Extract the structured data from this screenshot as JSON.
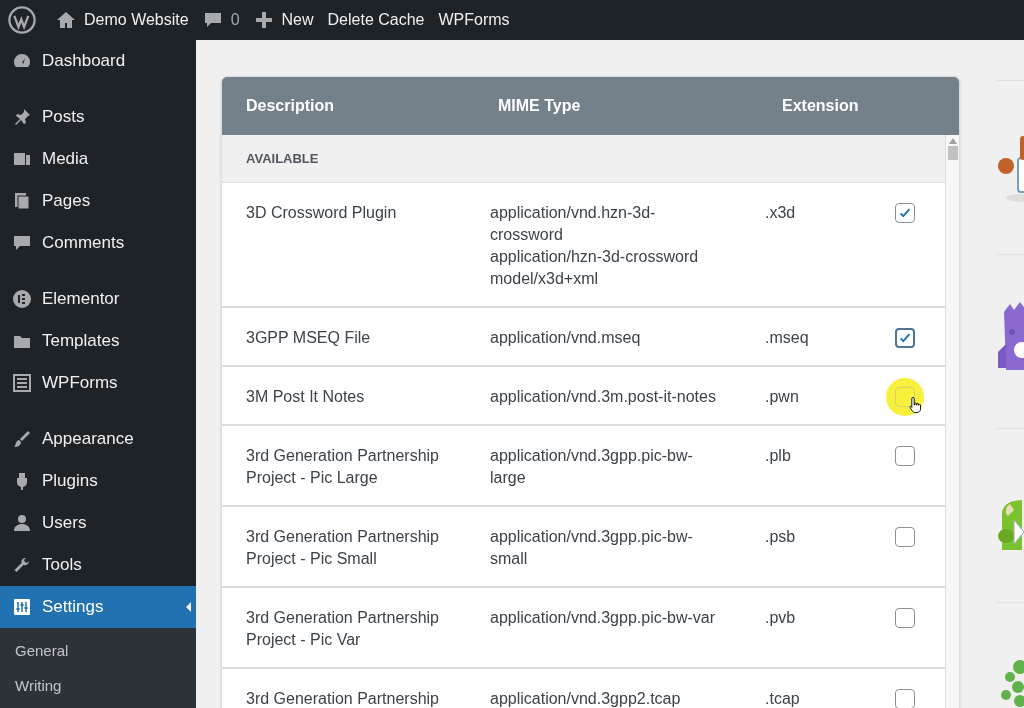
{
  "admin_bar": {
    "items": [
      {
        "kind": "logo"
      },
      {
        "kind": "home",
        "label": "Demo Website"
      },
      {
        "kind": "comments",
        "label": "0"
      },
      {
        "kind": "new",
        "label": "New"
      },
      {
        "kind": "text",
        "label": "Delete Cache"
      },
      {
        "kind": "text",
        "label": "WPForms"
      }
    ]
  },
  "sidebar": {
    "items": [
      {
        "kind": "dashboard",
        "label": "Dashboard",
        "selected": false,
        "group_start": false
      },
      {
        "kind": "pin",
        "label": "Posts",
        "selected": false,
        "group_start": true
      },
      {
        "kind": "media",
        "label": "Media",
        "selected": false,
        "group_start": false
      },
      {
        "kind": "pages",
        "label": "Pages",
        "selected": false,
        "group_start": false
      },
      {
        "kind": "comments",
        "label": "Comments",
        "selected": false,
        "group_start": false
      },
      {
        "kind": "elementor",
        "label": "Elementor",
        "selected": false,
        "group_start": true
      },
      {
        "kind": "folder",
        "label": "Templates",
        "selected": false,
        "group_start": false
      },
      {
        "kind": "forms",
        "label": "WPForms",
        "selected": false,
        "group_start": false
      },
      {
        "kind": "brush",
        "label": "Appearance",
        "selected": false,
        "group_start": true
      },
      {
        "kind": "plug",
        "label": "Plugins",
        "selected": false,
        "group_start": false
      },
      {
        "kind": "user",
        "label": "Users",
        "selected": false,
        "group_start": false
      },
      {
        "kind": "wrench",
        "label": "Tools",
        "selected": false,
        "group_start": false
      },
      {
        "kind": "sliders",
        "label": "Settings",
        "selected": true,
        "group_start": false
      }
    ],
    "submenu": [
      "General",
      "Writing"
    ]
  },
  "table": {
    "columns": [
      "Description",
      "MIME Type",
      "Extension"
    ],
    "section": "AVAILABLE",
    "rows": [
      {
        "description": "3D Crossword Plugin",
        "mime_types": [
          "application/vnd.hzn-3d-crossword",
          "application/hzn-3d-crossword",
          "model/x3d+xml"
        ],
        "extension": ".x3d",
        "checked": true,
        "focused": false,
        "hovered": false
      },
      {
        "description": "3GPP MSEQ File",
        "mime_types": [
          "application/vnd.mseq"
        ],
        "extension": ".mseq",
        "checked": true,
        "focused": true,
        "hovered": false
      },
      {
        "description": "3M Post It Notes",
        "mime_types": [
          "application/vnd.3m.post-it-notes"
        ],
        "extension": ".pwn",
        "checked": false,
        "focused": false,
        "hovered": true
      },
      {
        "description": "3rd Generation Partnership Project - Pic Large",
        "mime_types": [
          "application/vnd.3gpp.pic-bw-large"
        ],
        "extension": ".plb",
        "checked": false,
        "focused": false,
        "hovered": false
      },
      {
        "description": "3rd Generation Partnership Project - Pic Small",
        "mime_types": [
          "application/vnd.3gpp.pic-bw-small"
        ],
        "extension": ".psb",
        "checked": false,
        "focused": false,
        "hovered": false
      },
      {
        "description": "3rd Generation Partnership Project - Pic Var",
        "mime_types": [
          "application/vnd.3gpp.pic-bw-var"
        ],
        "extension": ".pvb",
        "checked": false,
        "focused": false,
        "hovered": false
      },
      {
        "description": "3rd Generation Partnership",
        "mime_types": [
          "application/vnd.3gpp2.tcap"
        ],
        "extension": ".tcap",
        "checked": false,
        "focused": false,
        "hovered": false
      }
    ]
  }
}
